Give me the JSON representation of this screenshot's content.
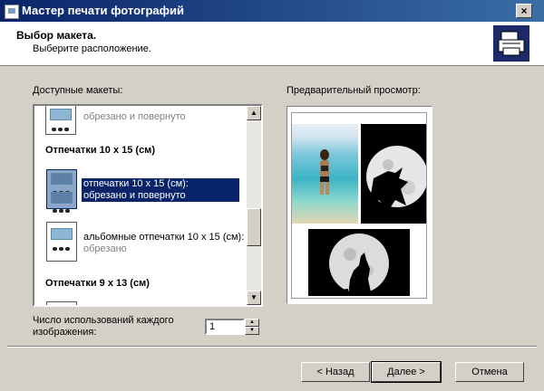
{
  "window": {
    "title": "Мастер печати фотографий",
    "close": "×"
  },
  "header": {
    "title": "Выбор макета.",
    "subtitle": "Выберите расположение."
  },
  "layouts": {
    "label": "Доступные макеты:",
    "items": [
      {
        "type": "layout",
        "title": "",
        "subtitle": "обрезано и повернуто"
      },
      {
        "type": "group",
        "title": "Отпечатки 10 x 15 (см)"
      },
      {
        "type": "layout",
        "title": "отпечатки 10 x 15 (см):",
        "subtitle": "обрезано и повернуто",
        "selected": true
      },
      {
        "type": "layout",
        "title": "альбомные отпечатки 10 x 15 (см):",
        "subtitle": "обрезано"
      },
      {
        "type": "group",
        "title": "Отпечатки 9 x 13 (см)"
      }
    ]
  },
  "preview": {
    "label": "Предварительный просмотр:"
  },
  "copies": {
    "label_line1": "Число использований каждого",
    "label_line2": "изображения:",
    "value": "1"
  },
  "buttons": {
    "back": "< Назад",
    "next": "Далее >",
    "cancel": "Отмена"
  },
  "colors": {
    "title_bar": "#0a246a",
    "selection": "#0a246a",
    "dialog_bg": "#d4d0c8"
  }
}
